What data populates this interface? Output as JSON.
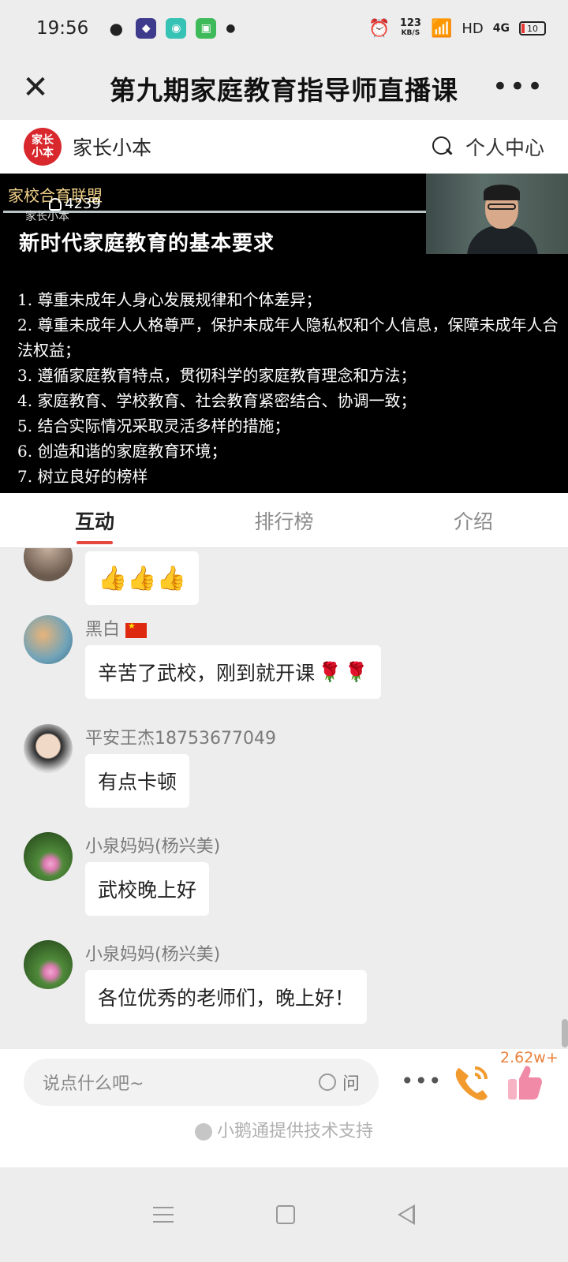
{
  "status_bar": {
    "time": "19:56",
    "speed": "123",
    "speed_unit": "KB/S",
    "hd": "HD",
    "network": "4G",
    "battery": "10"
  },
  "title_bar": {
    "title": "第九期家庭教育指导师直播课",
    "close_icon": "close-icon",
    "more_icon": "more-icon"
  },
  "site_header": {
    "logo_text": "家长小本",
    "site_name": "家长小本",
    "personal_center": "个人中心"
  },
  "video": {
    "brand": "家校合育联盟",
    "viewer_count": "4239",
    "subtitle": "家长小本",
    "slide_title": "新时代家庭教育的基本要求",
    "points": [
      "1. 尊重未成年人身心发展规律和个体差异；",
      "2. 尊重未成年人人格尊严，保护未成年人隐私权和个人信息，保障未成年人合法权益；",
      "3. 遵循家庭教育特点，贯彻科学的家庭教育理念和方法；",
      "4. 家庭教育、学校教育、社会教育紧密结合、协调一致；",
      "5. 结合实际情况采取灵活多样的措施；",
      "6. 创造和谐的家庭教育环境；",
      "7. 树立良好的榜样"
    ]
  },
  "tabs": [
    {
      "label": "互动",
      "active": true
    },
    {
      "label": "排行榜",
      "active": false
    },
    {
      "label": "介绍",
      "active": false
    }
  ],
  "messages": [
    {
      "name": "",
      "text": "👍👍👍"
    },
    {
      "name": "黑白",
      "text": "辛苦了武校，刚到就开课"
    },
    {
      "name": "平安王杰18753677049",
      "text": "有点卡顿"
    },
    {
      "name": "小泉妈妈(杨兴美)",
      "text": "武校晚上好"
    },
    {
      "name": "小泉妈妈(杨兴美)",
      "text": "各位优秀的老师们，晚上好！"
    }
  ],
  "input_bar": {
    "placeholder": "说点什么吧~",
    "ask_label": "问",
    "like_count": "2.62w+",
    "support_text": "小鹅通提供技术支持"
  },
  "colors": {
    "accent_red": "#e5483d",
    "like_orange": "#e8813a",
    "logo_red": "#d8282d"
  }
}
